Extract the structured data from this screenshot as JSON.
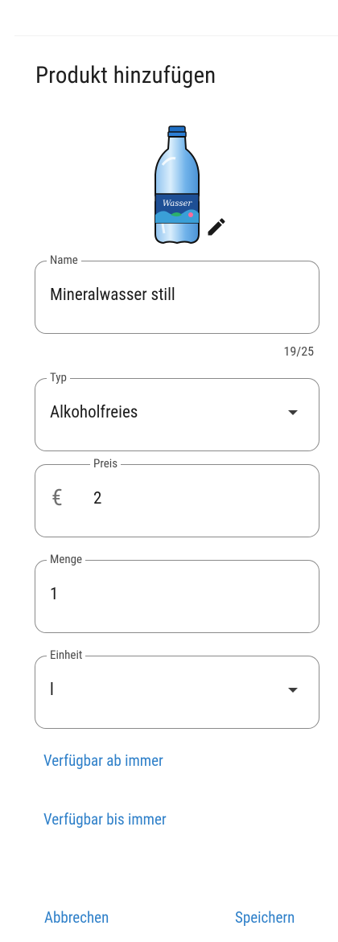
{
  "dialog": {
    "title": "Produkt hinzufügen"
  },
  "product_image": {
    "label_text": "Wasser"
  },
  "name_field": {
    "label": "Name",
    "value": "Mineralwasser still",
    "counter": "19/25"
  },
  "type_field": {
    "label": "Typ",
    "value": "Alkoholfreies"
  },
  "price_field": {
    "label": "Preis",
    "currency_symbol": "€",
    "value": "2"
  },
  "quantity_field": {
    "label": "Menge",
    "value": "1"
  },
  "unit_field": {
    "label": "Einheit",
    "value": "l"
  },
  "availability": {
    "from_label": "Verfügbar ab immer",
    "until_label": "Verfügbar bis immer"
  },
  "actions": {
    "cancel_label": "Abbrechen",
    "save_label": "Speichern"
  },
  "colors": {
    "accent": "#2f80c9",
    "outline": "#8a8a8a",
    "title": "#1f1f1f"
  },
  "icons": {
    "edit": "pencil-icon",
    "dropdown": "arrow-drop-down-icon",
    "currency": "euro-icon"
  }
}
